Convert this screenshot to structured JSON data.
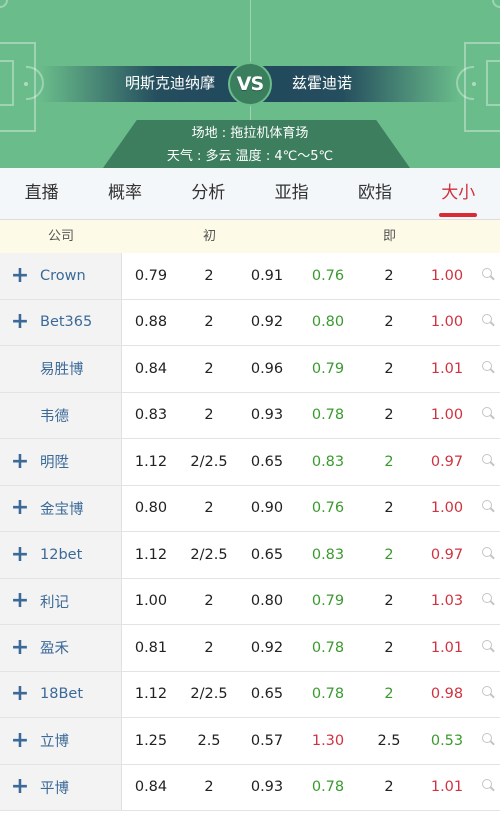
{
  "match": {
    "home_team": "明斯克迪纳摩",
    "vs_label": "VS",
    "away_team": "兹霍迪诺",
    "venue": "场地 : 拖拉机体育场",
    "weather": "天气 : 多云 温度 : 4℃～5℃"
  },
  "tabs": [
    {
      "label": "直播",
      "active": false
    },
    {
      "label": "概率",
      "active": false
    },
    {
      "label": "分析",
      "active": false
    },
    {
      "label": "亚指",
      "active": false
    },
    {
      "label": "欧指",
      "active": false
    },
    {
      "label": "大小",
      "active": true
    }
  ],
  "columns": {
    "company": "公司",
    "initial": "初",
    "live": "即"
  },
  "colors": {
    "accent_red": "#d92b34",
    "up_red": "#cf3340",
    "down_green": "#3b9a2f",
    "company_blue": "#3b6a98",
    "pitch_green": "#6abd8b"
  },
  "rows": [
    {
      "company": "Crown",
      "expandable": true,
      "init": [
        "0.79",
        "2",
        "0.91"
      ],
      "live": [
        {
          "v": "0.76",
          "c": "green"
        },
        {
          "v": "2",
          "c": ""
        },
        {
          "v": "1.00",
          "c": "red"
        }
      ]
    },
    {
      "company": "Bet365",
      "expandable": true,
      "init": [
        "0.88",
        "2",
        "0.92"
      ],
      "live": [
        {
          "v": "0.80",
          "c": "green"
        },
        {
          "v": "2",
          "c": ""
        },
        {
          "v": "1.00",
          "c": "red"
        }
      ]
    },
    {
      "company": "易胜博",
      "expandable": false,
      "init": [
        "0.84",
        "2",
        "0.96"
      ],
      "live": [
        {
          "v": "0.79",
          "c": "green"
        },
        {
          "v": "2",
          "c": ""
        },
        {
          "v": "1.01",
          "c": "red"
        }
      ]
    },
    {
      "company": "韦德",
      "expandable": false,
      "init": [
        "0.83",
        "2",
        "0.93"
      ],
      "live": [
        {
          "v": "0.78",
          "c": "green"
        },
        {
          "v": "2",
          "c": ""
        },
        {
          "v": "1.00",
          "c": "red"
        }
      ]
    },
    {
      "company": "明陞",
      "expandable": true,
      "init": [
        "1.12",
        "2/2.5",
        "0.65"
      ],
      "live": [
        {
          "v": "0.83",
          "c": "green"
        },
        {
          "v": "2",
          "c": "green"
        },
        {
          "v": "0.97",
          "c": "red"
        }
      ]
    },
    {
      "company": "金宝博",
      "expandable": true,
      "init": [
        "0.80",
        "2",
        "0.90"
      ],
      "live": [
        {
          "v": "0.76",
          "c": "green"
        },
        {
          "v": "2",
          "c": ""
        },
        {
          "v": "1.00",
          "c": "red"
        }
      ]
    },
    {
      "company": "12bet",
      "expandable": true,
      "init": [
        "1.12",
        "2/2.5",
        "0.65"
      ],
      "live": [
        {
          "v": "0.83",
          "c": "green"
        },
        {
          "v": "2",
          "c": "green"
        },
        {
          "v": "0.97",
          "c": "red"
        }
      ]
    },
    {
      "company": "利记",
      "expandable": true,
      "init": [
        "1.00",
        "2",
        "0.80"
      ],
      "live": [
        {
          "v": "0.79",
          "c": "green"
        },
        {
          "v": "2",
          "c": ""
        },
        {
          "v": "1.03",
          "c": "red"
        }
      ]
    },
    {
      "company": "盈禾",
      "expandable": true,
      "init": [
        "0.81",
        "2",
        "0.92"
      ],
      "live": [
        {
          "v": "0.78",
          "c": "green"
        },
        {
          "v": "2",
          "c": ""
        },
        {
          "v": "1.01",
          "c": "red"
        }
      ]
    },
    {
      "company": "18Bet",
      "expandable": true,
      "init": [
        "1.12",
        "2/2.5",
        "0.65"
      ],
      "live": [
        {
          "v": "0.78",
          "c": "green"
        },
        {
          "v": "2",
          "c": "green"
        },
        {
          "v": "0.98",
          "c": "red"
        }
      ]
    },
    {
      "company": "立博",
      "expandable": true,
      "init": [
        "1.25",
        "2.5",
        "0.57"
      ],
      "live": [
        {
          "v": "1.30",
          "c": "red"
        },
        {
          "v": "2.5",
          "c": ""
        },
        {
          "v": "0.53",
          "c": "green"
        }
      ]
    },
    {
      "company": "平博",
      "expandable": true,
      "init": [
        "0.84",
        "2",
        "0.93"
      ],
      "live": [
        {
          "v": "0.78",
          "c": "green"
        },
        {
          "v": "2",
          "c": ""
        },
        {
          "v": "1.01",
          "c": "red"
        }
      ]
    }
  ]
}
